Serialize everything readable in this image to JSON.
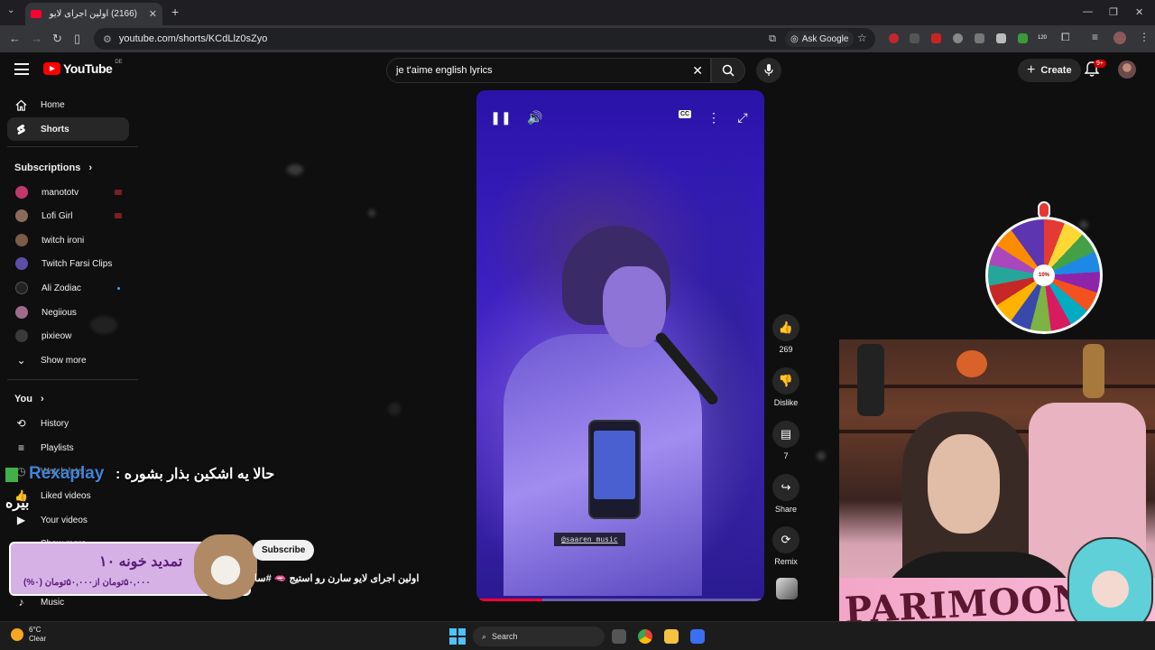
{
  "browser": {
    "tab_title": "(2166) اولین اجرای لایو سارن",
    "url": "youtube.com/shorts/KCdLlz0sZyo",
    "ask_google": "Ask Google",
    "ext_badge": "120"
  },
  "header": {
    "logo_text": "YouTube",
    "country_code": "DE",
    "search_value": "je t'aime english lyrics",
    "create_label": "Create",
    "notif_count": "9+"
  },
  "sidebar": {
    "main": [
      {
        "label": "Home",
        "icon": "home-icon"
      },
      {
        "label": "Shorts",
        "icon": "shorts-icon"
      }
    ],
    "subscriptions_title": "Subscriptions",
    "subscriptions": [
      {
        "label": "manototv",
        "color": "#c0396b",
        "live": true
      },
      {
        "label": "Lofi Girl",
        "color": "#8a6a5a",
        "live": true
      },
      {
        "label": "twitch ironi",
        "color": "#7b5c48",
        "live": false
      },
      {
        "label": "Twitch Farsi Clips",
        "color": "#5b4ea6",
        "live": false
      },
      {
        "label": "Ali Zodiac",
        "color": "#222222",
        "live": false,
        "new": true
      },
      {
        "label": "Negiious",
        "color": "#a06b8a",
        "live": false
      },
      {
        "label": "pixieow",
        "color": "#3a3a3a",
        "live": false
      }
    ],
    "show_more": "Show more",
    "you_title": "You",
    "you_items": [
      {
        "label": "History",
        "icon": "history-icon"
      },
      {
        "label": "Playlists",
        "icon": "playlists-icon"
      },
      {
        "label": "Watch later",
        "icon": "watch-later-icon"
      },
      {
        "label": "Liked videos",
        "icon": "like-icon"
      },
      {
        "label": "Your videos",
        "icon": "your-videos-icon"
      }
    ],
    "show_more_2": "Show more",
    "music": "Music"
  },
  "player": {
    "handle": "@saaren_music",
    "progress_fraction": 0.23
  },
  "actions": {
    "like_count": "269",
    "dislike_label": "Dislike",
    "comment_count": "7",
    "share_label": "Share",
    "remix_label": "Remix"
  },
  "overlay": {
    "brand": "Rexaplay",
    "announce_line1": "حالا یه اشکین بذار بشوره :",
    "announce_line2": "بیره",
    "promo_title": "تمدید خونه ۱۰",
    "promo_price": "۵۰,۰۰۰تومان از۵۰,۰۰۰تومان (۰%)",
    "subscribe_label": "Subscribe",
    "video_title": "اولین اجرای لایو سارن رو استیج 🫦 #سا",
    "wheel_center": "10%",
    "stream_banner": "PARIMOON"
  },
  "taskbar": {
    "temperature": "6°C",
    "weather": "Clear",
    "search_label": "Search"
  },
  "colors": {
    "yt_red": "#ff0000",
    "accent_blue": "#4cc2ff",
    "player_purple": "#3a1fc0"
  }
}
